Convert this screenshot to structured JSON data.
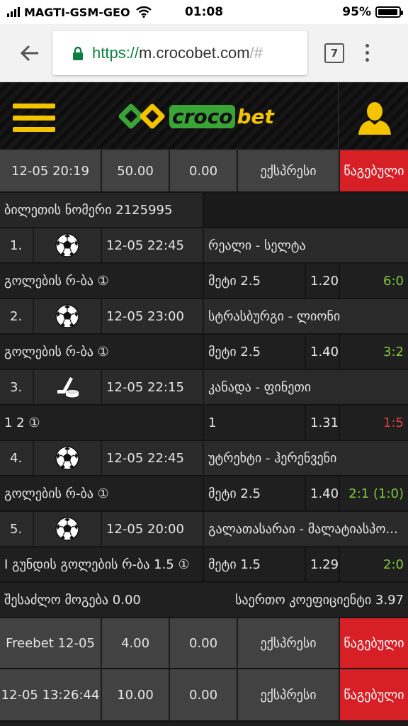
{
  "statusbar": {
    "carrier": "MAGTI-GSM-GEO",
    "time": "01:08",
    "battery": "95%",
    "battery_level": 0.95
  },
  "browser": {
    "url_scheme": "https://",
    "url_host": "m.crocobet.com",
    "url_rest": "/#",
    "tab_count": "7"
  },
  "site": {
    "logo_croco": "croco",
    "logo_bet": "bet",
    "accent": "#f5c400",
    "brand_green": "#3aa537"
  },
  "bet1": {
    "date": "12-05",
    "time": "20:19",
    "stake": "50.00",
    "win": "0.00",
    "type": "ექსპრესი",
    "status": "წაგებული",
    "ticket": "ბილეთის ნომერი 2125995",
    "events": [
      {
        "num": "1.",
        "sport": "soccer-ball-icon",
        "datetime": "12-05 22:45",
        "match": "რეალი - სელტა",
        "market": "გოლების რ-ბა ①",
        "pick": "მეტი 2.5",
        "odds": "1.20",
        "score": "6:0",
        "result": "win"
      },
      {
        "num": "2.",
        "sport": "soccer-ball-icon",
        "datetime": "12-05 23:00",
        "match": "სტრასბურგი - ლიონი",
        "market": "გოლების რ-ბა ①",
        "pick": "მეტი 2.5",
        "odds": "1.40",
        "score": "3:2",
        "result": "win"
      },
      {
        "num": "3.",
        "sport": "hockey-icon",
        "datetime": "12-05 22:15",
        "match": "კანადა - ფინეთი",
        "market": "1 2 ①",
        "pick": "1",
        "odds": "1.31",
        "score": "1:5",
        "result": "loss"
      },
      {
        "num": "4.",
        "sport": "soccer-ball-icon",
        "datetime": "12-05 22:45",
        "match": "უტრეხტი - ჰერენვენი",
        "market": "გოლების რ-ბა ①",
        "pick": "მეტი 2.5",
        "odds": "1.40",
        "score": "2:1 (1:0)",
        "result": "win"
      },
      {
        "num": "5.",
        "sport": "soccer-ball-icon",
        "datetime": "12-05 20:00",
        "match": "გალათასარაი - მალატიასპო...",
        "market": "I გუნდის გოლების რ-ბა 1.5 ①",
        "pick": "მეტი 1.5",
        "odds": "1.29",
        "score": "2:0",
        "result": "win"
      }
    ],
    "possible_win": "შესაძლო მოგება 0.00",
    "total_odds": "საერთო კოეფიციენტი 3.97"
  },
  "bet2": {
    "label": "Freebet 12-05",
    "stake": "4.00",
    "win": "0.00",
    "type": "ექსპრესი",
    "status": "წაგებული"
  },
  "bet3": {
    "date": "12-05",
    "time": "13:26:44",
    "stake": "10.00",
    "win": "0.00",
    "type": "ექსპრესი",
    "status": "წაგებული"
  }
}
